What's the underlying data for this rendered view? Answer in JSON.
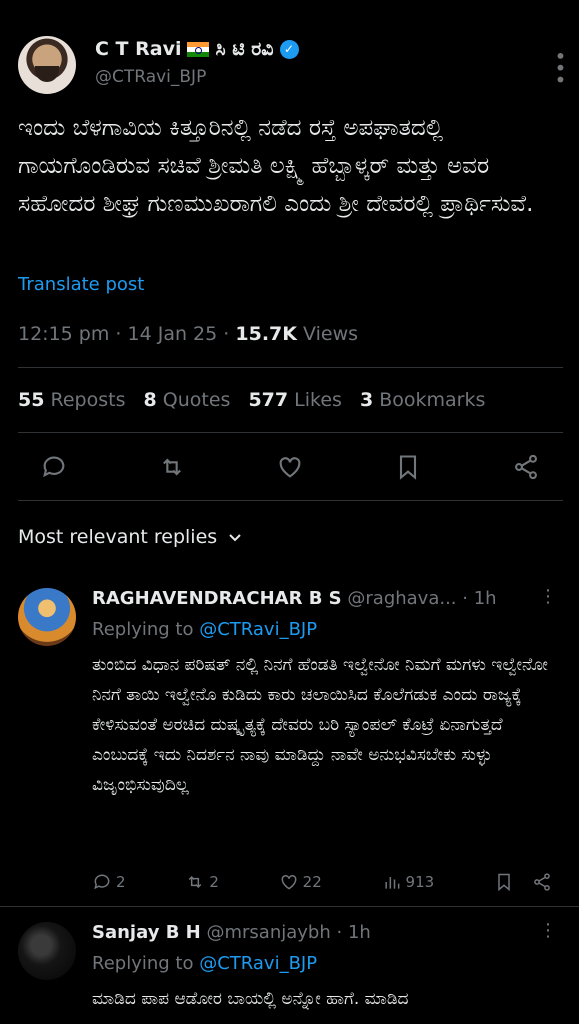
{
  "post": {
    "author_name": "C T Ravi",
    "author_name_local": "ಸಿ ಟಿ ರವಿ",
    "handle": "@CTRavi_BJP",
    "text": "ಇಂದು ಬೆಳಗಾವಿಯ ಕಿತ್ತೂರಿನಲ್ಲಿ ನಡೆದ ರಸ್ತೆ ಅಪಘಾತದಲ್ಲಿ ಗಾಯಗೊಂಡಿರುವ ಸಚಿವೆ ಶ್ರೀಮತಿ ಲಕ್ಷ್ಮಿ ಹೆಬ್ಬಾಳ್ಕರ್ ಮತ್ತು ಅವರ ಸಹೋದರ ಶೀಘ್ರ ಗುಣಮುಖರಾಗಲಿ ಎಂದು ಶ್ರೀ ದೇವರಲ್ಲಿ ಪ್ರಾರ್ಥಿಸುವೆ.",
    "translate_label": "Translate post",
    "time": "12:15 pm",
    "date": "14 Jan 25",
    "views_count": "15.7K",
    "views_label": "Views",
    "reposts_count": "55",
    "reposts_label": "Reposts",
    "quotes_count": "8",
    "quotes_label": "Quotes",
    "likes_count": "577",
    "likes_label": "Likes",
    "bookmarks_count": "3",
    "bookmarks_label": "Bookmarks"
  },
  "sort": {
    "label": "Most relevant replies"
  },
  "replies": [
    {
      "name": "RAGHAVENDRACHAR B S",
      "handle": "@raghava...",
      "age": "1h",
      "replying_prefix": "Replying to",
      "replying_to": "@CTRavi_BJP",
      "text": "ತುಂಬಿದ ವಿಧಾನ ಪರಿಷತ್ ನಲ್ಲಿ ನಿನಗೆ ಹೆಂಡತಿ ಇಲ್ವೇನೋ ನಿಮಗೆ ಮಗಳು ಇಲ್ವೇನೋ ನಿನಗೆ ತಾಯಿ ಇಲ್ವೇನೊ ಕುಡಿದು ಕಾರು ಚಲಾಯಿಸಿದ ಕೊಲೆಗಡುಕ ಎಂದು ರಾಜ್ಯಕ್ಕೆ ಕೇಳಿಸುವಂತೆ ಅರಚಿದ ದುಷ್ಕೃತ್ಯಕ್ಕೆ ದೇವರು ಬರಿ ಸ್ಯಾಂಪಲ್ ಕೊಟ್ರೆ ಏನಾಗುತ್ತದೆ ಎಂಬುದಕ್ಕೆ ಇದು ನಿದರ್ಶನ ನಾವು ಮಾಡಿದ್ದು ನಾವೇ ಅನುಭವಿಸಬೇಕು ಸುಳ್ಳು ವಿಜೃಂಭಿಸುವುದಿಲ್ಲ",
      "replies_count": "2",
      "reposts_count": "2",
      "likes_count": "22",
      "views_count": "913"
    },
    {
      "name": "Sanjay B H",
      "handle": "@mrsanjaybh",
      "age": "1h",
      "replying_prefix": "Replying to",
      "replying_to": "@CTRavi_BJP",
      "text": "ಮಾಡಿದ ಪಾಪ ಆಡೋರ ಬಾಯಲ್ಲಿ ಅನ್ನೋ ಹಾಗೆ. ಮಾಡಿದ"
    }
  ],
  "colors": {
    "accent": "#1d9bf0",
    "muted": "#71767b",
    "text": "#e7e9ea",
    "background": "#000000"
  },
  "icons": [
    "more-icon",
    "verified-icon",
    "reply-icon",
    "repost-icon",
    "like-icon",
    "bookmark-icon",
    "share-icon",
    "views-icon",
    "chevron-down-icon"
  ]
}
